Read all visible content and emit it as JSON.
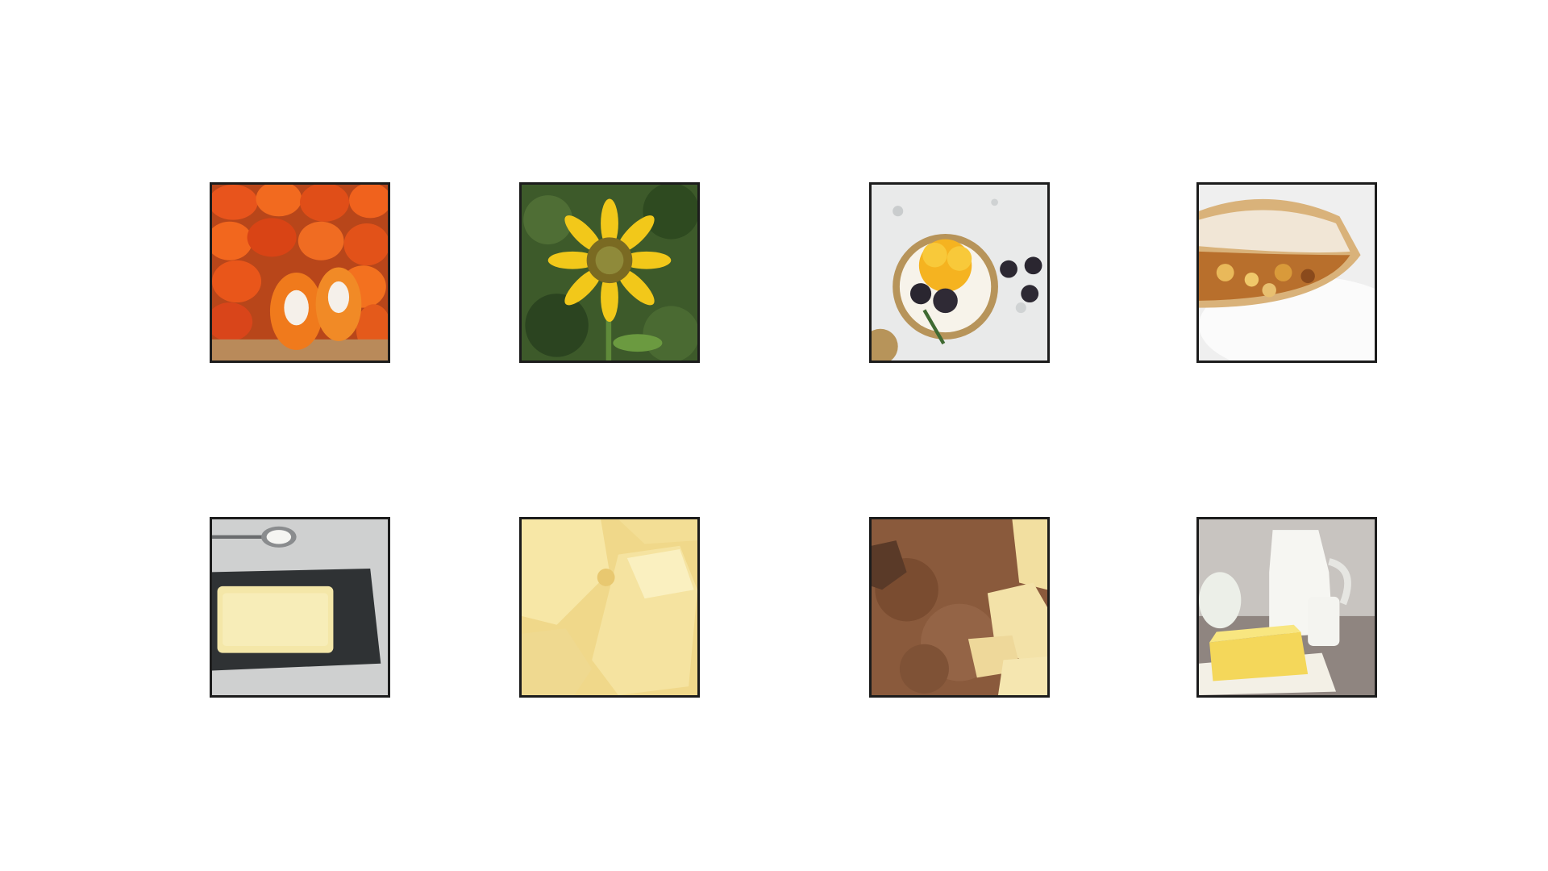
{
  "grid": {
    "rows": 2,
    "columns": 4,
    "tiles": [
      {
        "id": "palm-fruit",
        "icon": "palm-fruit-image"
      },
      {
        "id": "sunflower",
        "icon": "sunflower-image"
      },
      {
        "id": "fruit-tart",
        "icon": "fruit-tart-image"
      },
      {
        "id": "strudel",
        "icon": "strudel-image"
      },
      {
        "id": "butter-on-slate",
        "icon": "butter-slate-image"
      },
      {
        "id": "cocoa-butter-chunks",
        "icon": "cocoa-butter-image"
      },
      {
        "id": "cocoa-powder",
        "icon": "cocoa-powder-image"
      },
      {
        "id": "dairy-milk-butter",
        "icon": "dairy-image"
      }
    ]
  },
  "colors": {
    "background": "#ffffff",
    "tile_border": "#1c1c1c"
  }
}
